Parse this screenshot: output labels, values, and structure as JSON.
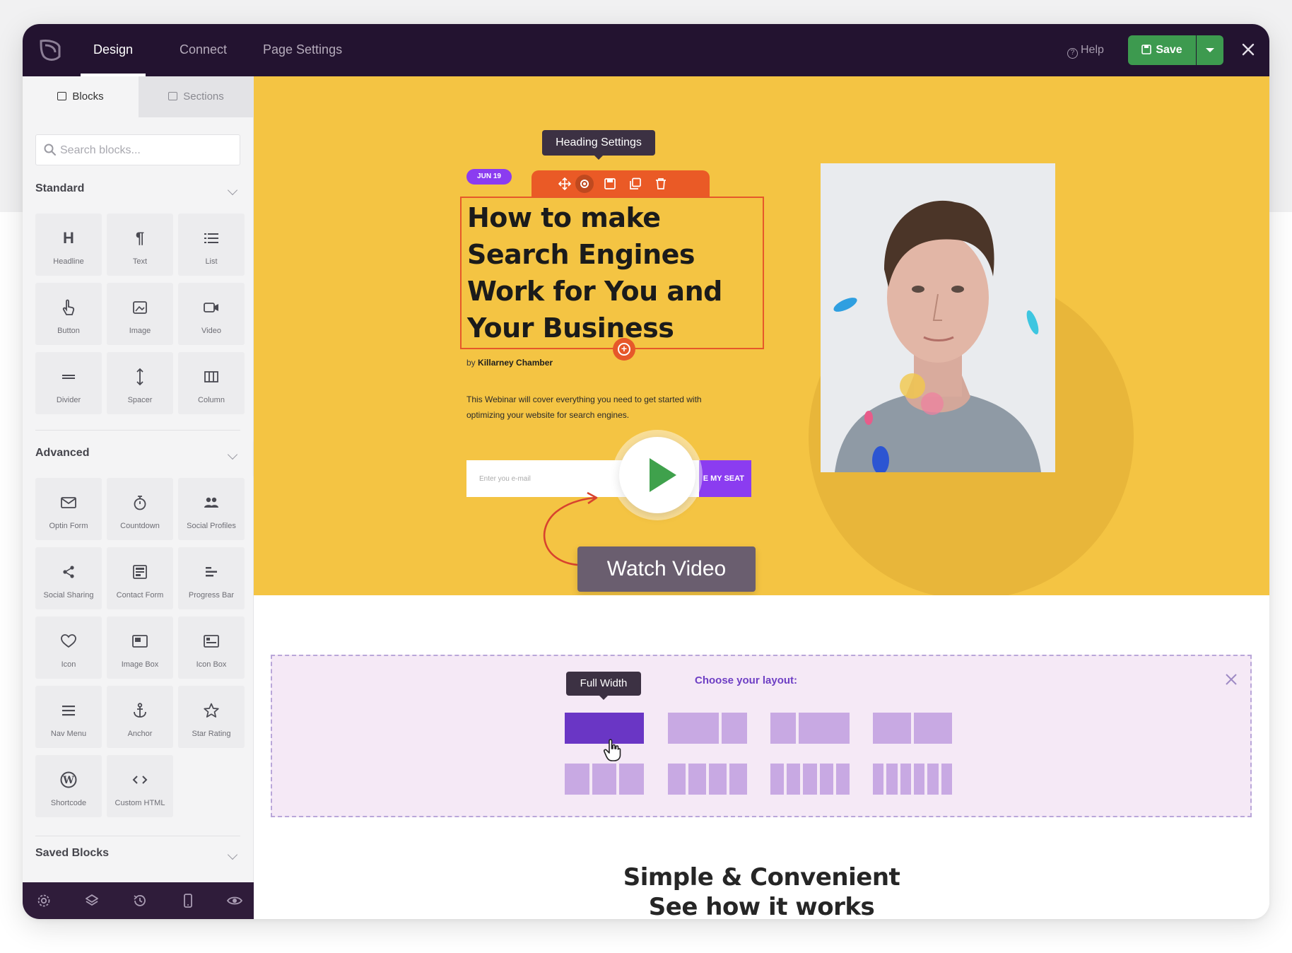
{
  "topbar": {
    "tabs": [
      {
        "label": "Design",
        "active": true
      },
      {
        "label": "Connect",
        "active": false
      },
      {
        "label": "Page Settings",
        "active": false
      }
    ],
    "help_label": "Help",
    "save_label": "Save"
  },
  "sidebar": {
    "tabs": [
      {
        "label": "Blocks",
        "icon": "blocks-icon",
        "active": true
      },
      {
        "label": "Sections",
        "icon": "sections-icon",
        "active": false
      }
    ],
    "search_placeholder": "Search blocks...",
    "categories": {
      "standard": {
        "label": "Standard",
        "items": [
          {
            "label": "Headline",
            "icon": "headline-icon"
          },
          {
            "label": "Text",
            "icon": "paragraph-icon"
          },
          {
            "label": "List",
            "icon": "list-icon"
          },
          {
            "label": "Button",
            "icon": "pointer-icon"
          },
          {
            "label": "Image",
            "icon": "image-icon"
          },
          {
            "label": "Video",
            "icon": "video-icon"
          },
          {
            "label": "Divider",
            "icon": "divider-icon"
          },
          {
            "label": "Spacer",
            "icon": "spacer-icon"
          },
          {
            "label": "Column",
            "icon": "column-icon"
          }
        ]
      },
      "advanced": {
        "label": "Advanced",
        "items": [
          {
            "label": "Optin Form",
            "icon": "envelope-icon"
          },
          {
            "label": "Countdown",
            "icon": "stopwatch-icon"
          },
          {
            "label": "Social Profiles",
            "icon": "users-icon"
          },
          {
            "label": "Social Sharing",
            "icon": "share-icon"
          },
          {
            "label": "Contact Form",
            "icon": "contact-form-icon"
          },
          {
            "label": "Progress Bar",
            "icon": "progress-bar-icon"
          },
          {
            "label": "Icon",
            "icon": "heart-icon"
          },
          {
            "label": "Image Box",
            "icon": "image-box-icon"
          },
          {
            "label": "Icon Box",
            "icon": "icon-box-icon"
          },
          {
            "label": "Nav Menu",
            "icon": "menu-icon"
          },
          {
            "label": "Anchor",
            "icon": "anchor-icon"
          },
          {
            "label": "Star Rating",
            "icon": "star-icon"
          },
          {
            "label": "Shortcode",
            "icon": "wordpress-icon"
          },
          {
            "label": "Custom HTML",
            "icon": "code-icon"
          }
        ]
      },
      "saved": {
        "label": "Saved Blocks"
      }
    },
    "footer_icons": [
      "settings-icon",
      "layers-icon",
      "history-icon",
      "mobile-icon",
      "preview-icon"
    ]
  },
  "canvas": {
    "hero": {
      "tooltip": "Heading Settings",
      "date_badge": "JUN 19",
      "headline": "How to make Search Engines Work for You and Your Business",
      "byline_prefix": "by",
      "byline_author": "Killarney Chamber",
      "description": "This Webinar will cover everything you need to get started with optimizing your website for search engines.",
      "email_placeholder": "Enter you e-mail",
      "cta_label": "E MY SEAT",
      "watch_video_label": "Watch Video",
      "toolbar_icons": [
        "move-icon",
        "settings-icon",
        "save-icon",
        "duplicate-icon",
        "trash-icon"
      ]
    },
    "layout_chooser": {
      "tooltip": "Full Width",
      "title": "Choose your layout:",
      "options": [
        {
          "columns": [
            1
          ],
          "selected": true
        },
        {
          "columns": [
            2,
            1
          ]
        },
        {
          "columns": [
            1,
            2
          ]
        },
        {
          "columns": [
            1,
            1
          ]
        },
        {
          "columns": [
            1,
            1,
            1
          ]
        },
        {
          "columns": [
            1,
            1,
            1,
            1
          ]
        },
        {
          "columns": [
            1,
            1,
            1,
            1,
            1
          ]
        },
        {
          "columns": [
            1,
            1,
            1,
            1,
            1,
            1
          ]
        }
      ]
    },
    "bottom_heading": {
      "line1": "Simple & Convenient",
      "line2": "See how it works"
    }
  },
  "colors": {
    "topbar_bg": "#231330",
    "hero_bg": "#f4c443",
    "accent_purple": "#8b3cf0",
    "save_green": "#3d9a4f",
    "selection_orange": "#e6582a"
  }
}
